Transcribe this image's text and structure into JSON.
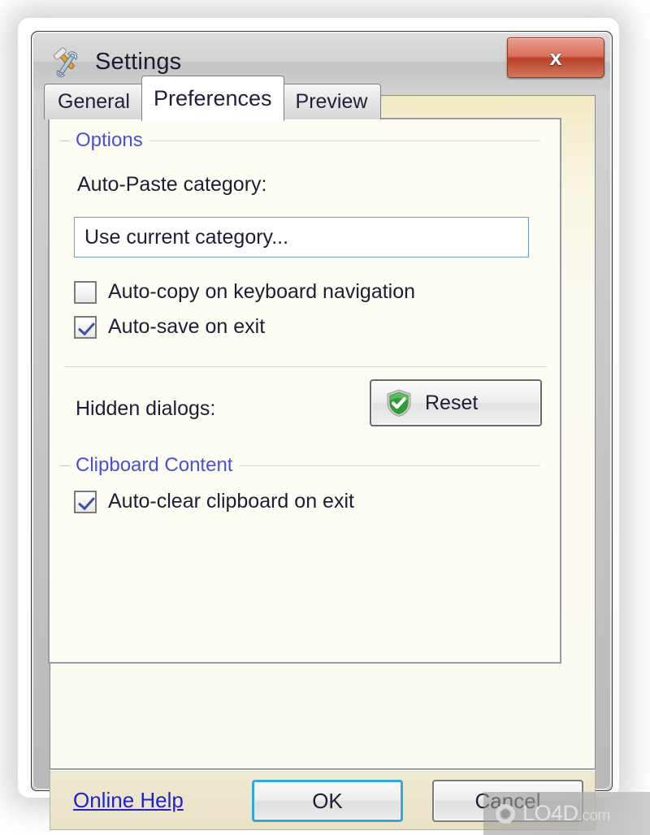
{
  "window": {
    "title": "Settings",
    "title_icon": "wrench-hammer-icon",
    "close_label": "x"
  },
  "tabs": [
    {
      "label": "General",
      "active": false
    },
    {
      "label": "Preferences",
      "active": true
    },
    {
      "label": "Preview",
      "active": false
    }
  ],
  "options_group": {
    "label": "Options",
    "category_field_label": "Auto-Paste category:",
    "category_value": "Use current category...",
    "checkboxes": [
      {
        "label": "Auto-copy on keyboard navigation",
        "checked": false
      },
      {
        "label": "Auto-save on exit",
        "checked": true
      }
    ],
    "hidden_dialogs_label": "Hidden dialogs:",
    "reset_button_label": "Reset",
    "reset_button_icon": "green-shield-check-icon"
  },
  "clipboard_group": {
    "label": "Clipboard Content",
    "checkboxes": [
      {
        "label": "Auto-clear clipboard on exit",
        "checked": true
      }
    ]
  },
  "footer": {
    "help_link": "Online Help",
    "ok_label": "OK",
    "cancel_label": "Cancel"
  },
  "watermark": {
    "text": "LO4D",
    "suffix": ".com",
    "icon": "circular-arrows-icon"
  },
  "colors": {
    "accent_blue": "#4d4ddb",
    "link_blue": "#2222cc",
    "close_red": "#b83f28",
    "default_button_border": "#2fa8e0",
    "group_rule": "#ecd2e2",
    "shield_green": "#2f9c36"
  }
}
